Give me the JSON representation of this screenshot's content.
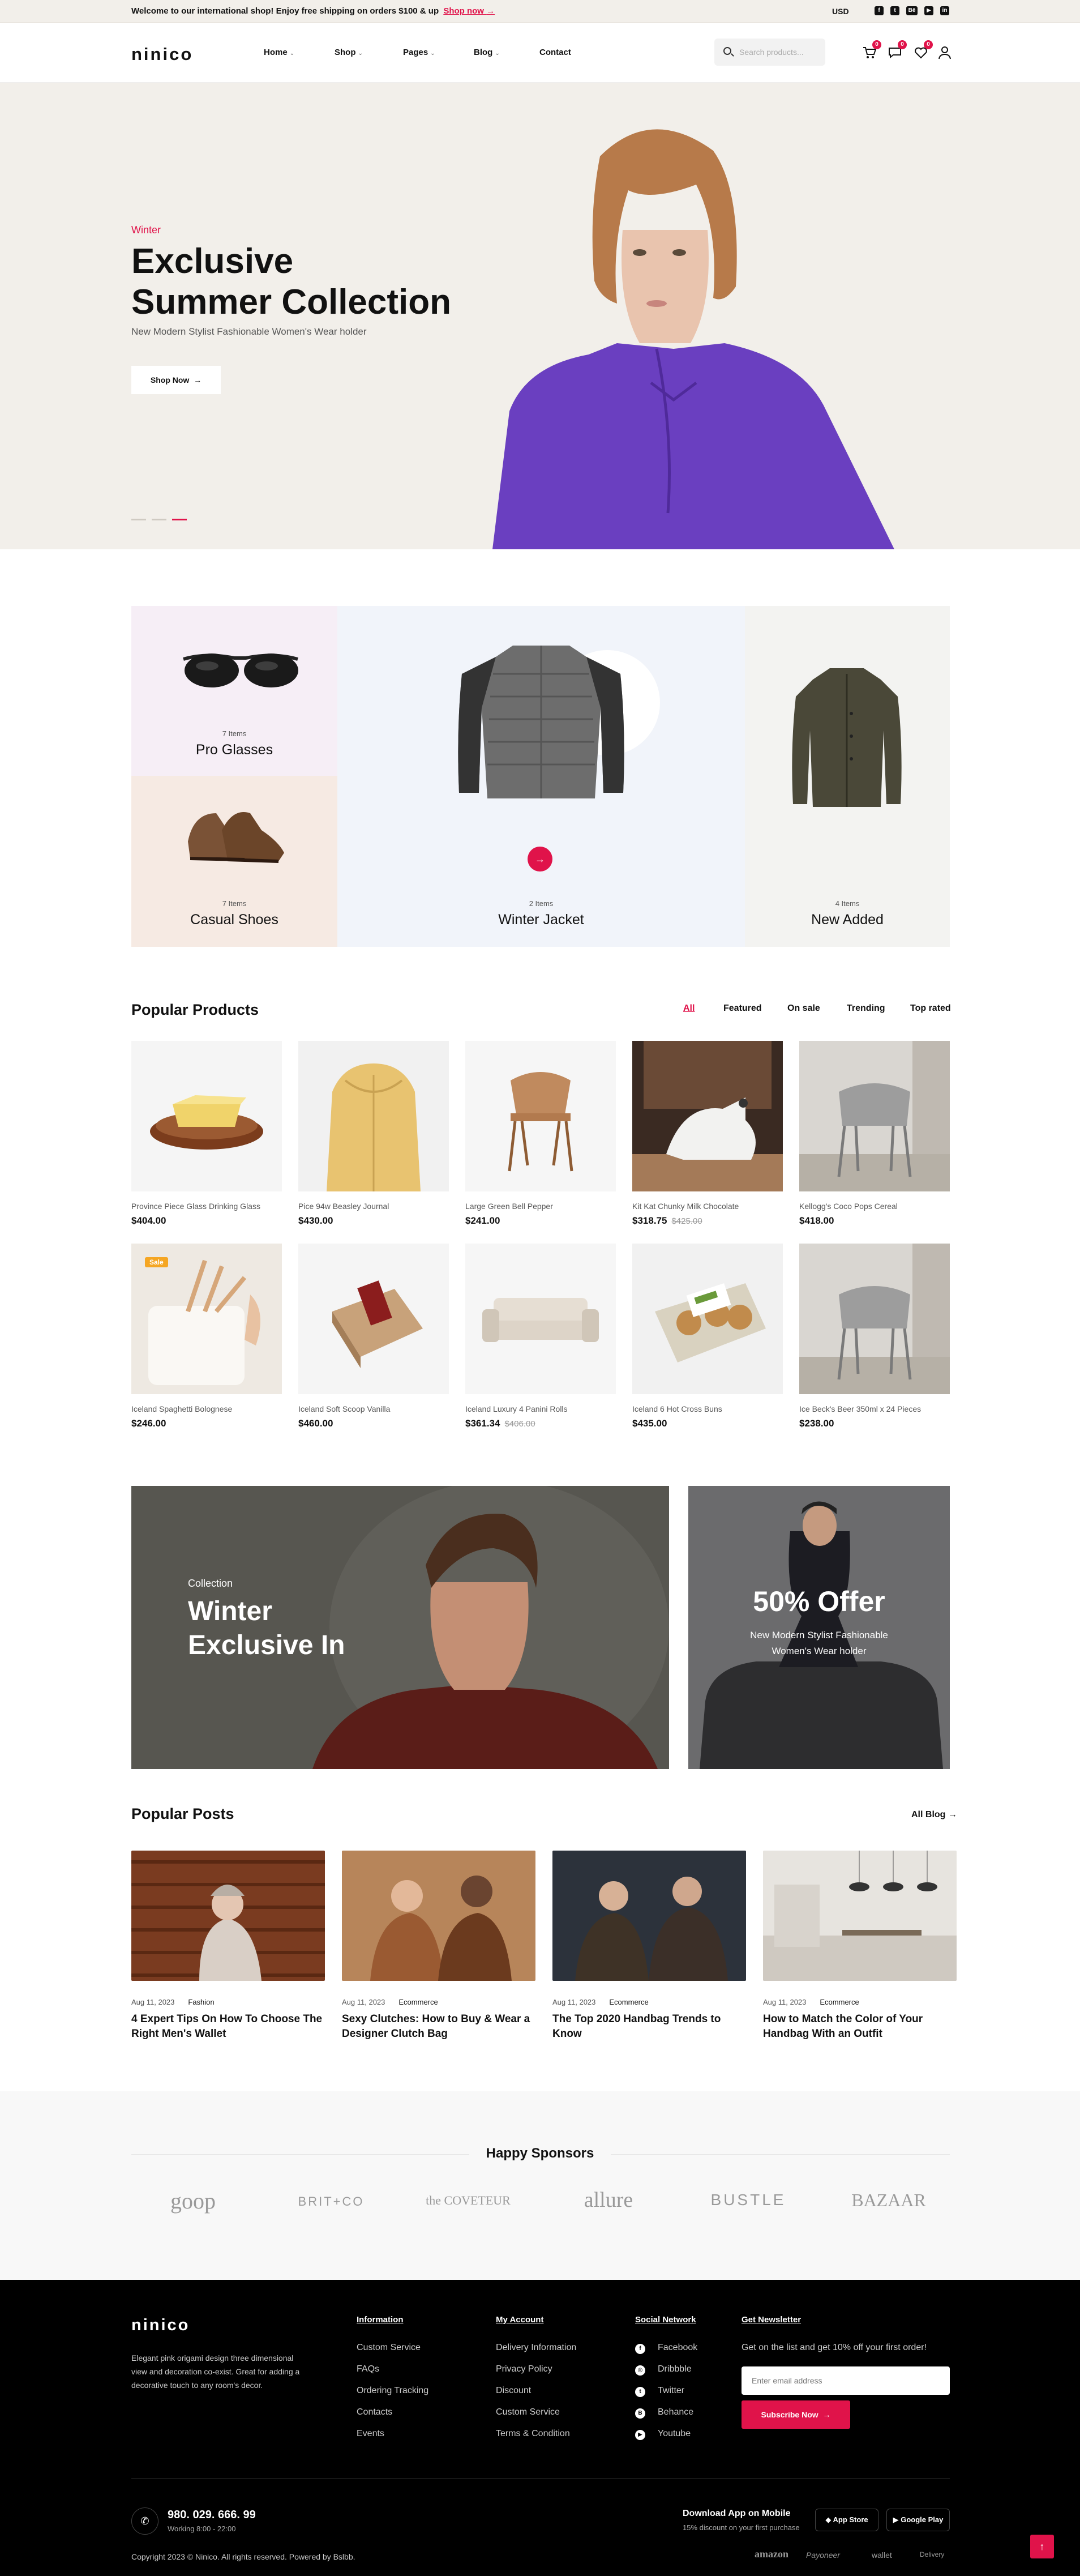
{
  "topbar": {
    "message": "Welcome to our international shop! Enjoy free shipping on orders $100 & up",
    "link": "Shop now",
    "link_arrow": "→",
    "currency": "USD",
    "social": [
      "f",
      "t",
      "Bē",
      "▶",
      "in"
    ]
  },
  "header": {
    "logo": "ninico",
    "nav": [
      {
        "label": "Home",
        "has_dropdown": true
      },
      {
        "label": "Shop",
        "has_dropdown": true
      },
      {
        "label": "Pages",
        "has_dropdown": true
      },
      {
        "label": "Blog",
        "has_dropdown": true
      },
      {
        "label": "Contact",
        "has_dropdown": false
      }
    ],
    "search_placeholder": "Search products...",
    "badges": {
      "cart": "0",
      "compare": "0",
      "wishlist": "0"
    }
  },
  "hero": {
    "subtitle": "Winter",
    "title_line1": "Exclusive",
    "title_line2": "Summer Collection",
    "description": "New Modern Stylist Fashionable Women's Wear holder",
    "button": "Shop Now",
    "button_arrow": "→"
  },
  "categories": [
    {
      "count": "7 Items",
      "name": "Pro Glasses"
    },
    {
      "count": "7 Items",
      "name": "Casual Shoes"
    },
    {
      "count": "2 Items",
      "name": "Winter Jacket"
    },
    {
      "count": "4 Items",
      "name": "New Added"
    }
  ],
  "popular_products": {
    "title": "Popular Products",
    "tabs": [
      "All",
      "Featured",
      "On sale",
      "Trending",
      "Top rated"
    ],
    "active_tab": "All",
    "items": [
      {
        "name": "Province Piece Glass Drinking Glass",
        "price": "$404.00",
        "old_price": ""
      },
      {
        "name": "Pice 94w Beasley Journal",
        "price": "$430.00",
        "old_price": ""
      },
      {
        "name": "Large Green Bell Pepper",
        "price": "$241.00",
        "old_price": ""
      },
      {
        "name": "Kit Kat Chunky Milk Chocolate",
        "price": "$318.75",
        "old_price": "$425.00"
      },
      {
        "name": "Kellogg's Coco Pops Cereal",
        "price": "$418.00",
        "old_price": ""
      },
      {
        "name": "Iceland Spaghetti Bolognese",
        "price": "$246.00",
        "old_price": "",
        "badge": "Sale"
      },
      {
        "name": "Iceland Soft Scoop Vanilla",
        "price": "$460.00",
        "old_price": ""
      },
      {
        "name": "Iceland Luxury 4 Panini Rolls",
        "price": "$361.34",
        "old_price": "$406.00"
      },
      {
        "name": "Iceland 6 Hot Cross Buns",
        "price": "$435.00",
        "old_price": ""
      },
      {
        "name": "Ice Beck's Beer 350ml x 24 Pieces",
        "price": "$238.00",
        "old_price": ""
      }
    ]
  },
  "banners": {
    "left": {
      "subtitle": "Collection",
      "title_line1": "Winter",
      "title_line2": "Exclusive In"
    },
    "right": {
      "title": "50% Offer",
      "desc_line1": "New Modern Stylist Fashionable",
      "desc_line2": "Women's Wear holder"
    }
  },
  "posts": {
    "title": "Popular Posts",
    "all_link": "All Blog",
    "all_arrow": "→",
    "items": [
      {
        "date": "Aug 11, 2023",
        "tag": "Fashion",
        "title": "4 Expert Tips On How To Choose The Right Men's Wallet"
      },
      {
        "date": "Aug 11, 2023",
        "tag": "Ecommerce",
        "title": "Sexy Clutches: How to Buy & Wear a Designer Clutch Bag"
      },
      {
        "date": "Aug 11, 2023",
        "tag": "Ecommerce",
        "title": "The Top 2020 Handbag Trends to Know"
      },
      {
        "date": "Aug 11, 2023",
        "tag": "Ecommerce",
        "title": "How to Match the Color of Your Handbag With an Outfit"
      }
    ]
  },
  "sponsors": {
    "title": "Happy Sponsors",
    "logos": [
      "goop",
      "BRIT+CO",
      "the COVETEUR",
      "allure",
      "BUSTLE",
      "BAZAAR"
    ]
  },
  "footer": {
    "logo": "ninico",
    "about": [
      "Elegant pink origami design three dimensional",
      "view and decoration co-exist. Great for adding a",
      "decorative touch to any room's decor."
    ],
    "information": {
      "title": "Information",
      "items": [
        "Custom Service",
        "FAQs",
        "Ordering Tracking",
        "Contacts",
        "Events"
      ]
    },
    "account": {
      "title": "My Account",
      "items": [
        "Delivery Information",
        "Privacy Policy",
        "Discount",
        "Custom Service",
        "Terms & Condition"
      ]
    },
    "social": {
      "title": "Social Network",
      "items": [
        "Facebook",
        "Dribbble",
        "Twitter",
        "Behance",
        "Youtube"
      ]
    },
    "newsletter": {
      "title": "Get Newsletter",
      "text": "Get on the list and get 10% off your first order!",
      "placeholder": "Enter email address",
      "button": "Subscribe Now",
      "arrow": "→"
    },
    "phone": "980. 029. 666. 99",
    "hours": "Working 8:00 - 22:00",
    "app_title": "Download App on Mobile",
    "app_sub": "15% discount on your first purchase",
    "app_store": "App Store",
    "google_play": "Google Play",
    "copyright": "Copyright 2023 © Ninico. All rights reserved. Powered by Bslbb.",
    "payments": [
      "amazon",
      "Payoneer",
      "wallet",
      "Delivery"
    ],
    "to_top": "↑"
  },
  "colors": {
    "accent": "#e0134a",
    "hero_bg": "#f2efea",
    "footer_bg": "#000000"
  }
}
